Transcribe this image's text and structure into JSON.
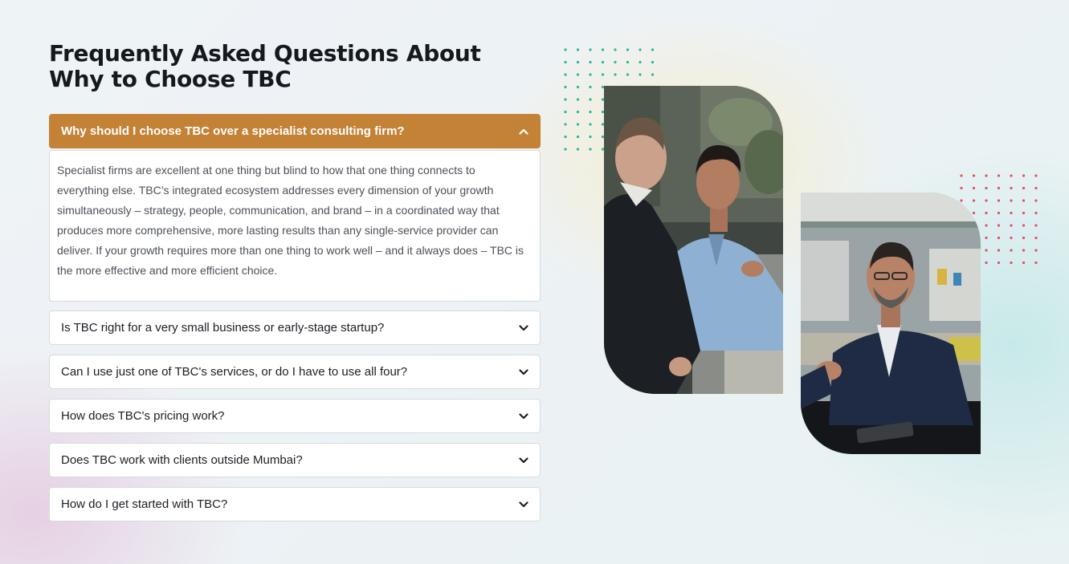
{
  "faq": {
    "title": "Frequently Asked Questions About Why to Choose TBC",
    "items": [
      {
        "question": "Why should I choose TBC over a specialist consulting firm?",
        "answer": "Specialist firms are excellent at one thing but blind to how that one thing connects to everything else. TBC’s integrated ecosystem addresses every dimension of your growth simultaneously – strategy, people, communication, and brand – in a coordinated way that produces more comprehensive, more lasting results than any single-service provider can deliver. If your growth requires more than one thing to work well – and it always does – TBC is the more effective and more efficient choice.",
        "expanded": true
      },
      {
        "question": "Is TBC right for a very small business or early-stage startup?",
        "expanded": false
      },
      {
        "question": "Can I use just one of TBC's services, or do I have to use all four?",
        "expanded": false
      },
      {
        "question": "How does TBC's pricing work?",
        "expanded": false
      },
      {
        "question": "Does TBC work with clients outside Mumbai?",
        "expanded": false
      },
      {
        "question": "How do I get started with TBC?",
        "expanded": false
      }
    ]
  },
  "icons": {
    "expanded": "chevron-up-icon",
    "collapsed": "chevron-down-icon"
  },
  "colors": {
    "accent": "#c48236",
    "teal_dots": "#2bb59a",
    "red_dots": "#e2506a"
  }
}
